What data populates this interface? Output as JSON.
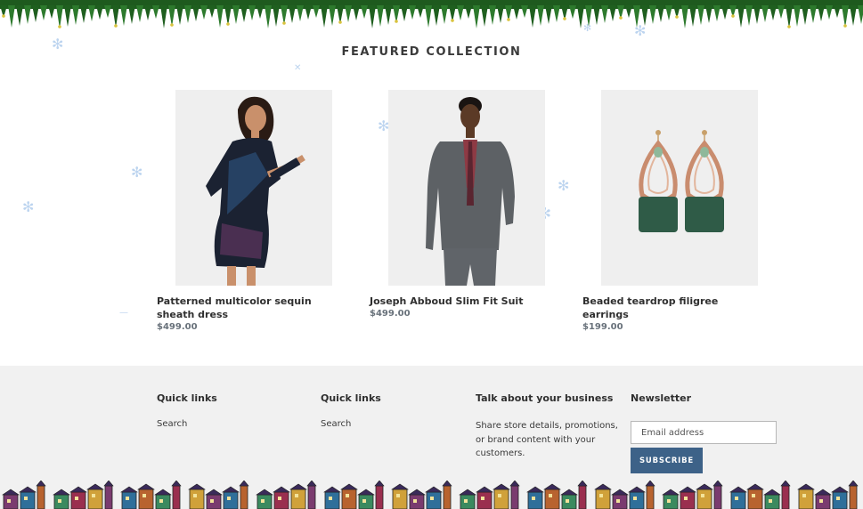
{
  "section": {
    "title": "FEATURED COLLECTION"
  },
  "products": [
    {
      "name": "Patterned multicolor sequin sheath dress",
      "price": "$499.00"
    },
    {
      "name": "Joseph Abboud Slim Fit Suit",
      "price": "$499.00"
    },
    {
      "name": "Beaded teardrop filigree earrings",
      "price": "$199.00"
    }
  ],
  "footer": {
    "quick_links_1": {
      "heading": "Quick links",
      "link": "Search"
    },
    "quick_links_2": {
      "heading": "Quick links",
      "link": "Search"
    },
    "business": {
      "heading": "Talk about your business",
      "text": "Share store details, promotions, or brand content with your customers."
    },
    "newsletter": {
      "heading": "Newsletter",
      "placeholder": "Email address",
      "button": "SUBSCRIBE"
    }
  },
  "colors": {
    "accent_button": "#3d6288",
    "footer_bg": "#f1f1f1",
    "garland": "#1e5a1e",
    "snowflake": "#bcd4ef"
  },
  "icons": [
    "snowflake-icon",
    "garland-decoration",
    "village-decoration"
  ]
}
